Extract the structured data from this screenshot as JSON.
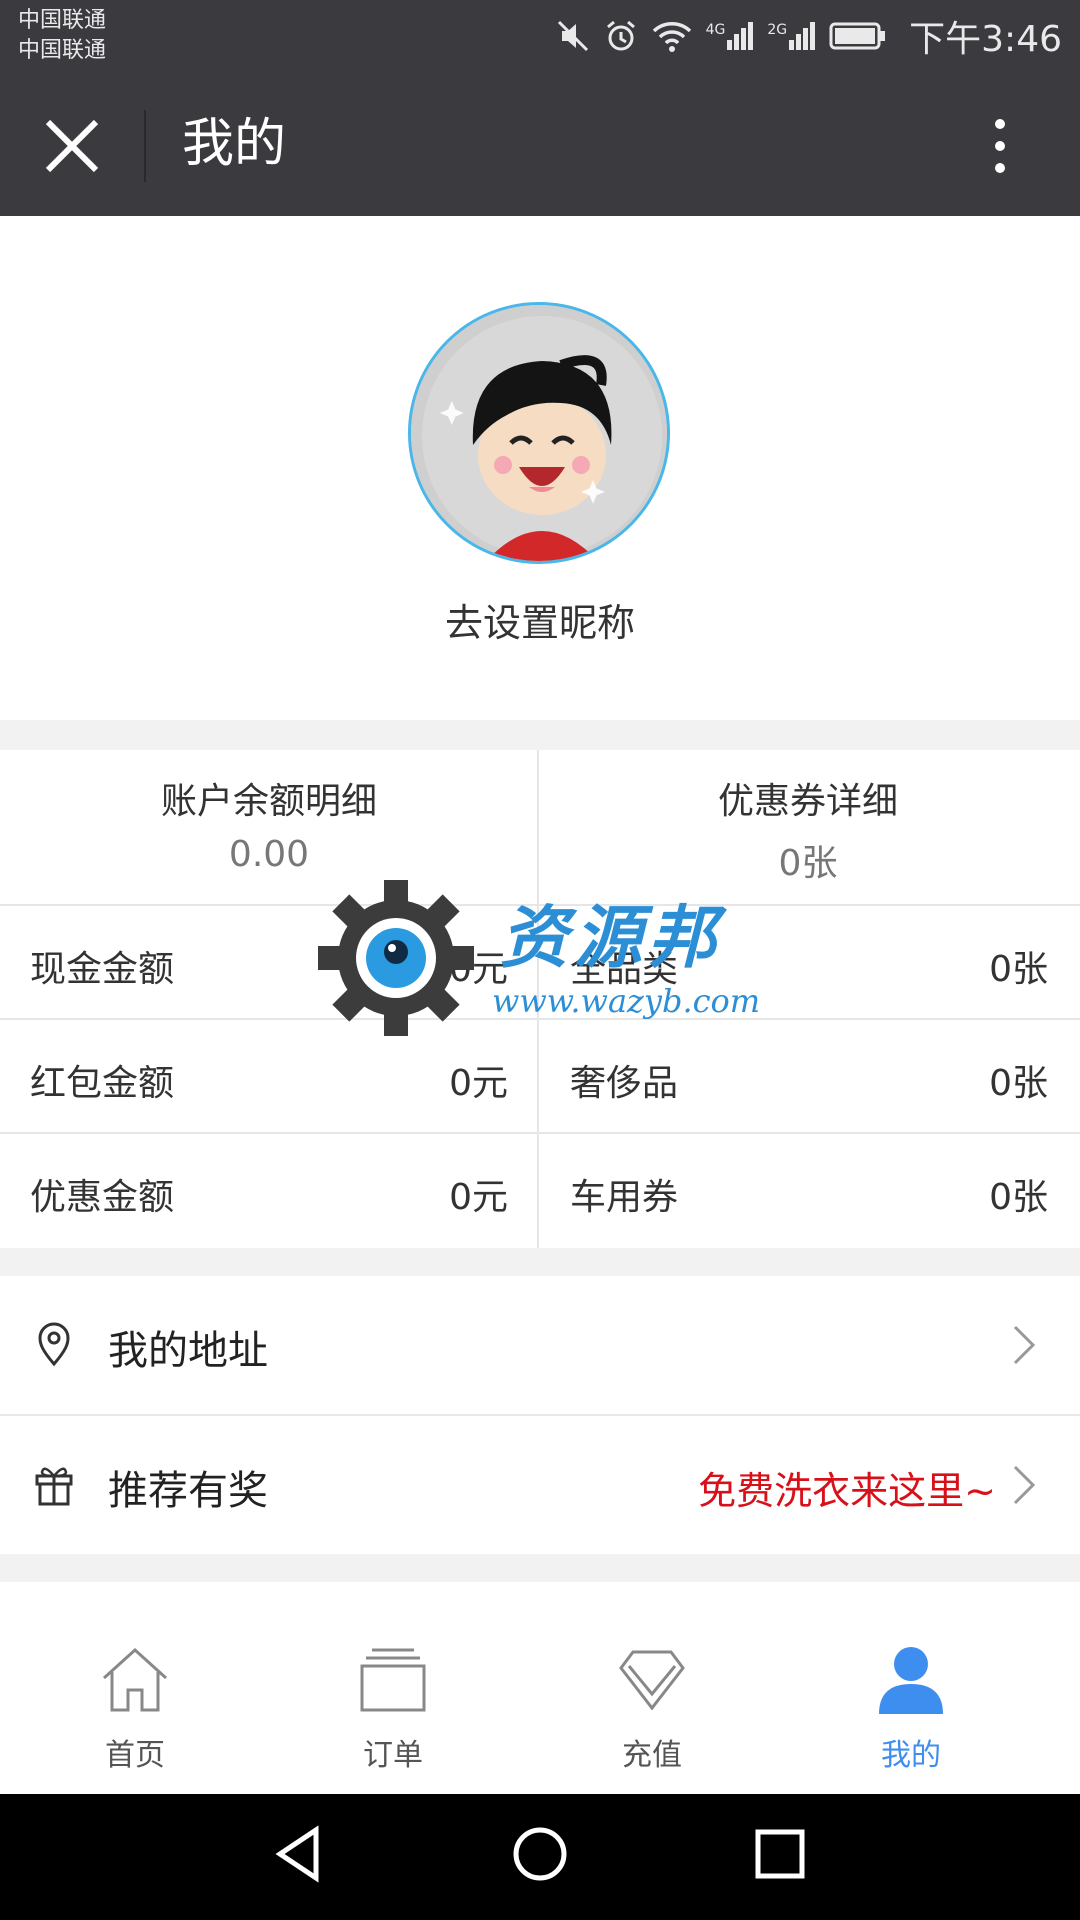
{
  "status_bar": {
    "carrier_1": "中国联通",
    "carrier_2": "中国联通",
    "network_1": "4G",
    "network_2": "2G",
    "time": "下午3:46"
  },
  "top_bar": {
    "title": "我的"
  },
  "profile": {
    "nickname": "去设置昵称"
  },
  "summary": {
    "balance_title": "账户余额明细",
    "balance_value": "0.00",
    "coupon_title": "优惠券详细",
    "coupon_value": "0张"
  },
  "balance_rows": [
    {
      "label": "现金金额",
      "value": "0元"
    },
    {
      "label": "红包金额",
      "value": "0元"
    },
    {
      "label": "优惠金额",
      "value": "0元"
    }
  ],
  "coupon_rows": [
    {
      "label": "全品类",
      "value": "0张"
    },
    {
      "label": "奢侈品",
      "value": "0张"
    },
    {
      "label": "车用券",
      "value": "0张"
    }
  ],
  "menu": {
    "address_label": "我的地址",
    "referral_label": "推荐有奖",
    "referral_promo": "免费洗衣来这里~"
  },
  "tabs": [
    {
      "label": "首页",
      "icon": "home-icon"
    },
    {
      "label": "订单",
      "icon": "orders-icon"
    },
    {
      "label": "充值",
      "icon": "diamond-icon"
    },
    {
      "label": "我的",
      "icon": "user-icon"
    }
  ],
  "watermark": {
    "title": "资源邦",
    "url": "www.wazyb.com"
  },
  "colors": {
    "header_bg": "#3a3a3f",
    "accent_blue": "#3e8ef0",
    "promo_red": "#d7101a",
    "avatar_ring": "#49b7ea"
  }
}
